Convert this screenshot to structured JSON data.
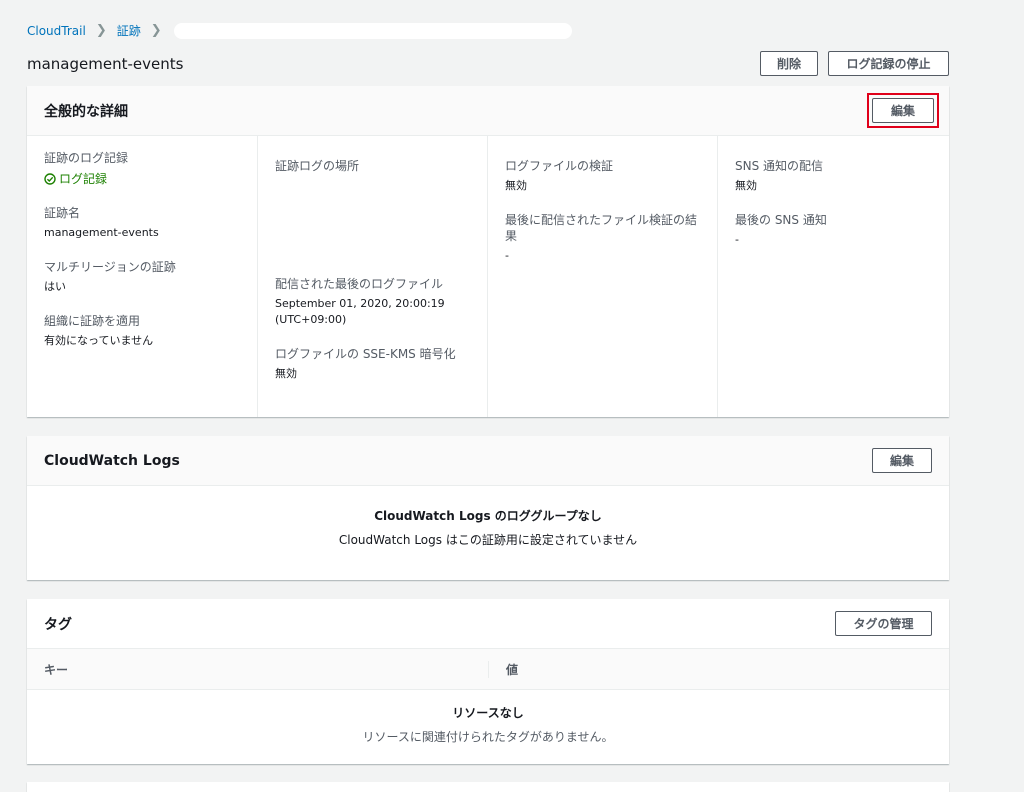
{
  "breadcrumb": {
    "root": "CloudTrail",
    "trails": "証跡"
  },
  "page": {
    "title": "management-events"
  },
  "header_actions": {
    "delete": "削除",
    "stop_logging": "ログ記録の停止"
  },
  "general": {
    "title": "全般的な詳細",
    "edit": "編集",
    "col1": {
      "logging_label": "証跡のログ記録",
      "logging_value": "ログ記録",
      "name_label": "証跡名",
      "name_value": "management-events",
      "multiregion_label": "マルチリージョンの証跡",
      "multiregion_value": "はい",
      "org_label": "組織に証跡を適用",
      "org_value": "有効になっていません"
    },
    "col2": {
      "location_label": "証跡ログの場所",
      "last_file_label": "配信された最後のログファイル",
      "last_file_value": "September 01, 2020, 20:00:19 (UTC+09:00)",
      "sse_label": "ログファイルの SSE-KMS 暗号化",
      "sse_value": "無効"
    },
    "col3": {
      "validation_label": "ログファイルの検証",
      "validation_value": "無効",
      "last_validation_label": "最後に配信されたファイル検証の結果",
      "last_validation_value": "-"
    },
    "col4": {
      "sns_label": "SNS 通知の配信",
      "sns_value": "無効",
      "last_sns_label": "最後の SNS 通知",
      "last_sns_value": "-"
    }
  },
  "cloudwatch": {
    "title": "CloudWatch Logs",
    "edit": "編集",
    "empty_title": "CloudWatch Logs のロググループなし",
    "empty_desc": "CloudWatch Logs はこの証跡用に設定されていません"
  },
  "tags": {
    "title": "タグ",
    "manage": "タグの管理",
    "columns": [
      "キー",
      "値"
    ],
    "empty_title": "リソースなし",
    "empty_desc": "リソースに関連付けられたタグがありません。"
  },
  "colors": {
    "link": "#0073bb",
    "success": "#1d8102",
    "highlight": "#e0001a"
  }
}
